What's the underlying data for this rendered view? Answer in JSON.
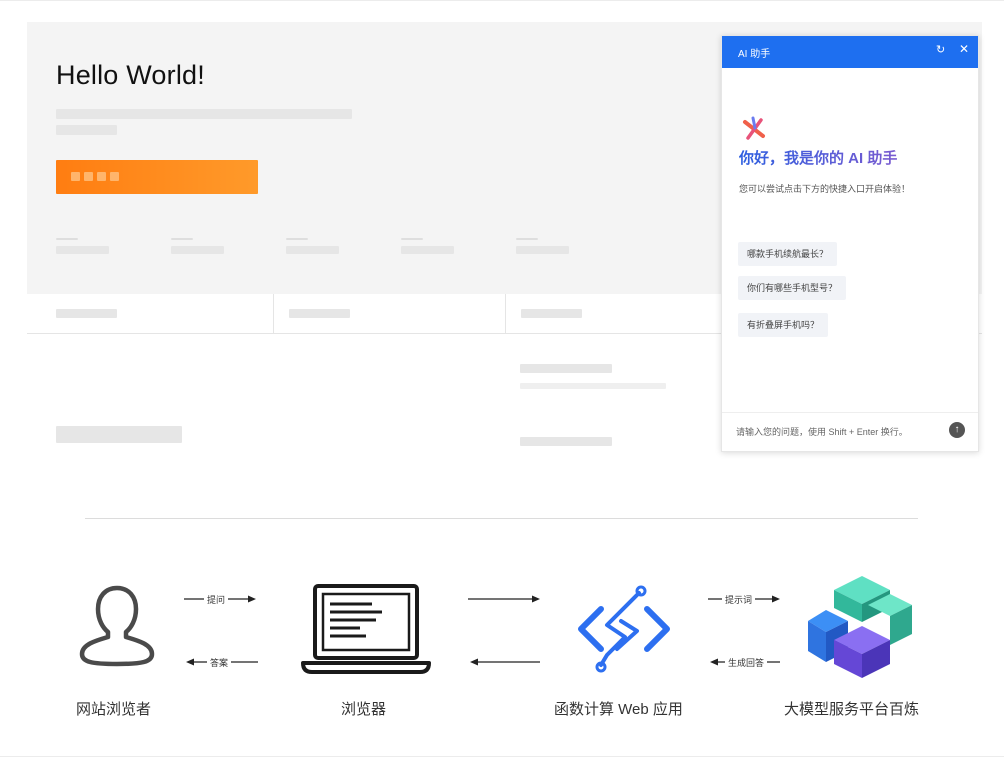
{
  "hero": {
    "title": "Hello World!"
  },
  "chat": {
    "title": "AI 助手",
    "refresh_icon": "refresh-icon",
    "close_icon": "close-icon",
    "greeting": "你好，我是你的 AI 助手",
    "subtitle": "您可以尝试点击下方的快捷入口开启体验！",
    "suggestions": [
      "哪款手机续航最长？",
      "你们有哪些手机型号？",
      "有折叠屏手机吗？"
    ],
    "input_placeholder": "请输入您的问题，使用 Shift + Enter 换行。",
    "header_color": "#1e6ff0"
  },
  "diagram": {
    "nodes": [
      "网站浏览者",
      "浏览器",
      "函数计算 Web 应用",
      "大模型服务平台百炼"
    ],
    "arrows": {
      "ask": "提问",
      "answer": "答案",
      "prompt": "提示词",
      "generate": "生成回答"
    },
    "icons": [
      "user-icon",
      "laptop-icon",
      "function-compute-icon",
      "model-cube-icon"
    ]
  }
}
